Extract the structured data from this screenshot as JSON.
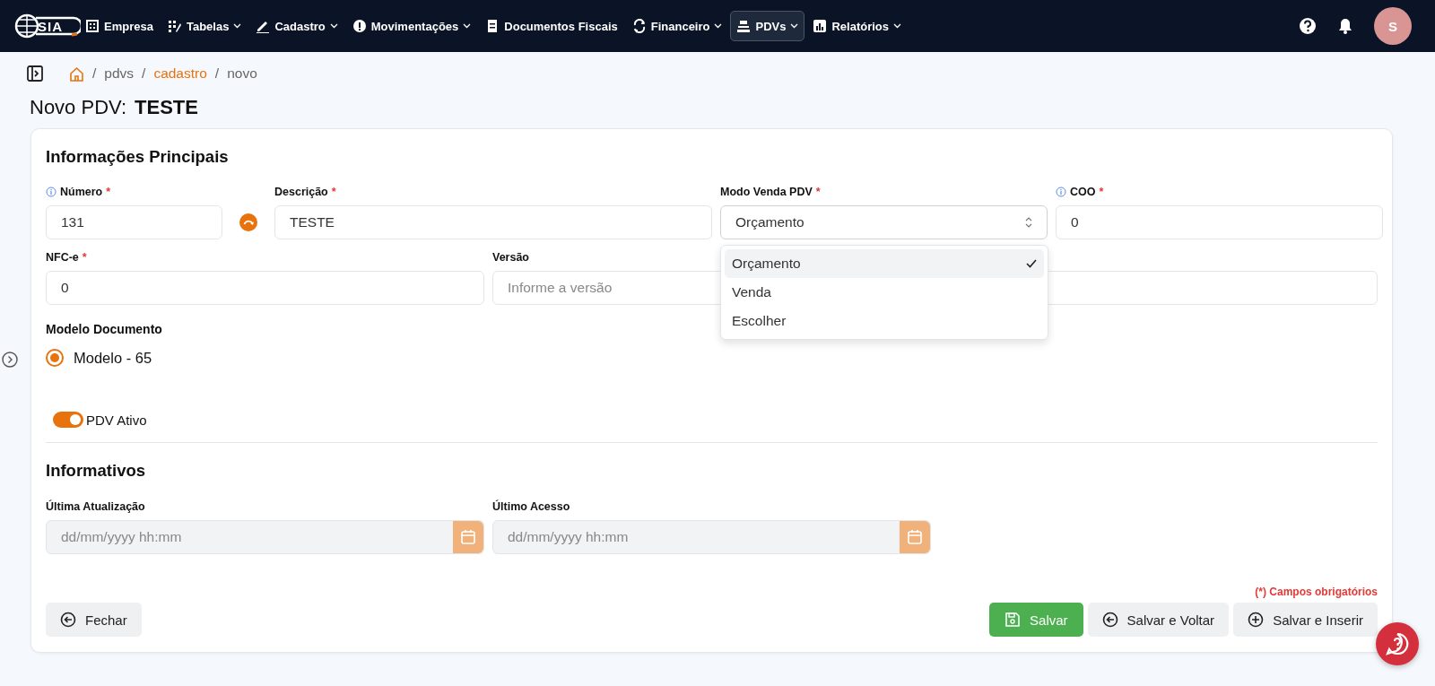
{
  "nav": {
    "logo": "SIA",
    "items": [
      {
        "label": "Empresa",
        "dropdown": false,
        "selected": false
      },
      {
        "label": "Tabelas",
        "dropdown": true,
        "selected": false
      },
      {
        "label": "Cadastro",
        "dropdown": true,
        "selected": false
      },
      {
        "label": "Movimentações",
        "dropdown": true,
        "selected": false
      },
      {
        "label": "Documentos Fiscais",
        "dropdown": false,
        "selected": false
      },
      {
        "label": "Financeiro",
        "dropdown": true,
        "selected": false
      },
      {
        "label": "PDVs",
        "dropdown": true,
        "selected": true
      },
      {
        "label": "Relatórios",
        "dropdown": true,
        "selected": false
      }
    ],
    "avatar": "S"
  },
  "breadcrumb": [
    {
      "separator": "/",
      "label": "pdvs",
      "kind": "plain"
    },
    {
      "separator": "/",
      "label": "cadastro",
      "kind": "link"
    },
    {
      "separator": "/",
      "label": "novo",
      "kind": "plain"
    }
  ],
  "title": {
    "prefix": "Novo PDV:",
    "name": "TESTE"
  },
  "main_section": {
    "title": "Informações Principais",
    "number": {
      "label": "Número",
      "info": true,
      "required_mark": "*",
      "value": "131"
    },
    "description": {
      "label": "Descrição",
      "info": false,
      "required_mark": "*",
      "value": "TESTE"
    },
    "sale_mode": {
      "label": "Modo Venda PDV",
      "info": false,
      "required_mark": "*",
      "value": "Orçamento",
      "expanded": true,
      "options": [
        {
          "label": "Orçamento",
          "selected": true
        },
        {
          "label": "Venda",
          "selected": false
        },
        {
          "label": "Escolher",
          "selected": false
        }
      ]
    },
    "coo": {
      "label": "COO",
      "info": true,
      "required_mark": "*",
      "value": "0"
    },
    "nfce": {
      "label": "NFC-e",
      "info": false,
      "required_mark": "*",
      "value": "0"
    },
    "version": {
      "label": "Versão",
      "info": false,
      "placeholder": "Informe a versão"
    },
    "document_model": {
      "label": "Modelo Documento",
      "options": [
        {
          "label": "Modelo - 65",
          "selected": true
        }
      ]
    },
    "active_toggle": {
      "label": "PDV Ativo",
      "on": true
    }
  },
  "info_section": {
    "title": "Informativos",
    "fields": [
      {
        "label": "Última Atualização",
        "placeholder": "dd/mm/yyyy hh:mm"
      },
      {
        "label": "Último Acesso",
        "placeholder": "dd/mm/yyyy hh:mm"
      }
    ]
  },
  "required_note": "(*) Campos obrigatórios",
  "buttons": [
    {
      "label": "Fechar",
      "kind": "back"
    },
    {
      "label": "Salvar",
      "kind": "save"
    },
    {
      "label": "Salvar e Voltar",
      "kind": "back"
    },
    {
      "label": "Salvar e Inserir",
      "kind": "add"
    }
  ]
}
